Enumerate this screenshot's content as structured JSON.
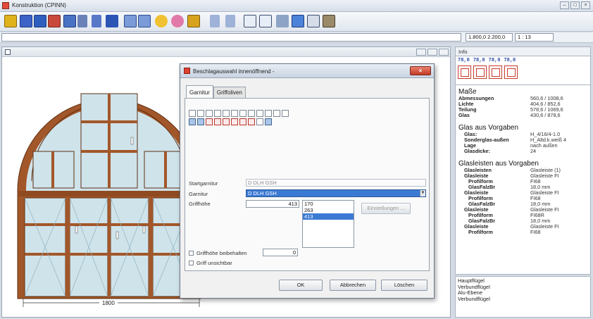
{
  "window": {
    "title": "Konstruktion (CPINN)"
  },
  "infobar": {
    "dimensions": "1.800,0  2.200,0",
    "scale": "1 : 13"
  },
  "drawing": {
    "dimension_label": "1800",
    "frame_color": "#a2572a",
    "glass_color": "#cfe3ea"
  },
  "dialog": {
    "title": "Beschlagauswahl innenöffnend -",
    "tabs": [
      {
        "label": "Garnitur",
        "active": true
      },
      {
        "label": "Griffoliven",
        "active": false
      }
    ],
    "startgarnitur_label": "Startgarnitur",
    "startgarnitur_value": "D DLH GSH",
    "garnitur_label": "Garnitur",
    "garnitur_value": "D DLH GSH",
    "griffhoehe_label": "Griffhöhe",
    "griffhoehe_value": "413",
    "griffhoehe_options": [
      "170",
      "263",
      "413"
    ],
    "griffhoehe_selected": "413",
    "einstellungen_label": "Einstellungen ...",
    "griffhoehe_beibehalten_label": "Griffhöhe beibehalten",
    "griffhoehe_beibehalten_value": "0",
    "griff_unsichtbar_label": "Griff unsichtbar",
    "ok_label": "OK",
    "abbrechen_label": "Abbrechen",
    "loeschen_label": "Löschen"
  },
  "info": {
    "header": "Info",
    "sizes": [
      "78,0",
      "78,0",
      "78,0",
      "78,0"
    ],
    "sections": [
      {
        "title": "Maße",
        "rows": [
          {
            "k": "Abmessungen",
            "v": "560,6  /  1008,6",
            "indent": 0
          },
          {
            "k": "Lichte",
            "v": "404,6  /   852,6",
            "indent": 0
          },
          {
            "k": "Teilung",
            "v": "578,6  /  1069,6",
            "indent": 0
          },
          {
            "k": "Glas",
            "v": "430,6  /   878,6",
            "indent": 0
          }
        ]
      },
      {
        "title": "Glas aus Vorgaben",
        "rows": [
          {
            "k": "Glas:",
            "v": "H_4/16/4-1.0",
            "indent": 1
          },
          {
            "k": "Sonderglas-außen",
            "v": "H_Altd.k.weiß 4",
            "indent": 1
          },
          {
            "k": "Lage",
            "v": "nach außen",
            "indent": 1
          },
          {
            "k": "Glasdicke:",
            "v": "24",
            "indent": 1
          }
        ]
      },
      {
        "title": "Glasleisten aus Vorgaben",
        "rows": [
          {
            "k": "Glasleisten",
            "v": "Glasleiste (1)",
            "indent": 1
          },
          {
            "k": "Glasleiste",
            "v": "Glasleiste FI",
            "indent": 1
          },
          {
            "k": "Profilform",
            "v": "FI68",
            "indent": 2
          },
          {
            "k": "GlasFalzBr",
            "v": "18,0  mm",
            "indent": 2
          },
          {
            "k": "Glasleiste",
            "v": "Glasleiste FI",
            "indent": 1
          },
          {
            "k": "Profilform",
            "v": "FI68",
            "indent": 2
          },
          {
            "k": "GlasFalzBr",
            "v": "18,0  mm",
            "indent": 2
          },
          {
            "k": "Glasleiste",
            "v": "Glasleiste FI",
            "indent": 1
          },
          {
            "k": "Profilform",
            "v": "FI68R",
            "indent": 2
          },
          {
            "k": "GlasFalzBr",
            "v": "18,0  mm",
            "indent": 2
          },
          {
            "k": "Glasleiste",
            "v": "Glasleiste FI",
            "indent": 1
          },
          {
            "k": "Profilform",
            "v": "FI68",
            "indent": 2
          }
        ]
      }
    ],
    "bottom_lines": [
      "Hauptflügel",
      "  Verbundflügel",
      "Alu-Ebene",
      "  Verbundflügel"
    ]
  }
}
